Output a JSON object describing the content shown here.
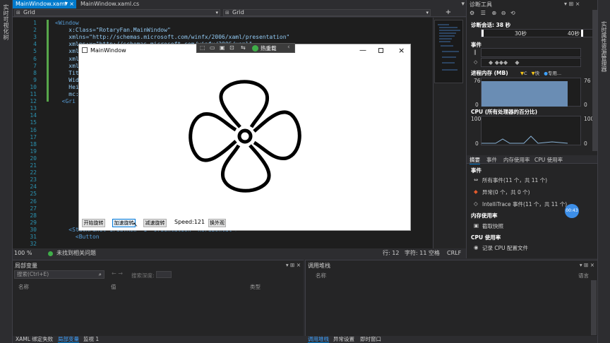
{
  "left_strip": {
    "label": "实时可视化树"
  },
  "right_strip": {
    "label": "实时属性资源管理器"
  },
  "doc_tabs": [
    {
      "label": "MainWindow.xaml",
      "pin": "▼",
      "close": "×"
    },
    {
      "label": "MainWindow.xaml.cs"
    }
  ],
  "dropdowns": {
    "left": "Grid",
    "right": "Grid"
  },
  "code_lines": [
    {
      "n": "1",
      "t": "<Window"
    },
    {
      "n": "2",
      "t": "    x:Class=\"RotaryFan.MainWindow\""
    },
    {
      "n": "3",
      "t": "    xmlns=\"http://schemas.microsoft.com/winfx/2006/xaml/presentation\""
    },
    {
      "n": "4",
      "t": "    xmlns:x=\"http://schemas.microsoft.com/winfx/2006/xaml\""
    },
    {
      "n": "5",
      "t": "    xmlns"
    },
    {
      "n": "6",
      "t": "    xmlns"
    },
    {
      "n": "7",
      "t": "    xmlns"
    },
    {
      "n": "8",
      "t": "    Titl"
    },
    {
      "n": "9",
      "t": "    Widt"
    },
    {
      "n": "10",
      "t": "    Heig"
    },
    {
      "n": "11",
      "t": "    mc:I"
    },
    {
      "n": "12",
      "t": "  <Gri"
    },
    {
      "n": "13",
      "t": ""
    },
    {
      "n": "14",
      "t": ""
    },
    {
      "n": "15",
      "t": ""
    },
    {
      "n": "16",
      "t": ""
    },
    {
      "n": "17",
      "t": ""
    },
    {
      "n": "18",
      "t": ""
    },
    {
      "n": "19",
      "t": ""
    },
    {
      "n": "20",
      "t": ""
    },
    {
      "n": "21",
      "t": ""
    },
    {
      "n": "22",
      "t": ""
    },
    {
      "n": "23",
      "t": ""
    },
    {
      "n": "24",
      "t": ""
    },
    {
      "n": "25",
      "t": ""
    },
    {
      "n": "26",
      "t": ""
    },
    {
      "n": "27",
      "t": ""
    },
    {
      "n": "28",
      "t": ""
    },
    {
      "n": "29",
      "t": ""
    },
    {
      "n": "30",
      "t": "    <StackPanel Grid.Row=\"1\" Orientation=\"Horizontal\">"
    },
    {
      "n": "31",
      "t": "      <Button"
    },
    {
      "n": "32",
      "t": ""
    }
  ],
  "editor_status": {
    "zoom": "100 %",
    "issues": "未找到相关问题",
    "line": "行: 12",
    "char": "字符: 11",
    "ws": "空格",
    "eol": "CRLF"
  },
  "app": {
    "title": "MainWindow",
    "buttons": [
      "开始旋转",
      "加速旋转",
      "减速旋转",
      "换外观"
    ],
    "speed_text": "Speed:121"
  },
  "hot_reload": {
    "label": "热重载"
  },
  "diag": {
    "title": "诊断工具",
    "session": "诊断会话: 38 秒",
    "t30": "30秒",
    "t40": "40秒",
    "events_header": "事件",
    "memory_header": "进程内存 (MB)",
    "memory_legend": [
      "C",
      "快",
      "专用..."
    ],
    "mem_max": "76",
    "mem_min": "0",
    "cpu_header": "CPU (所有处理器的百分比)",
    "cpu_max": "100",
    "cpu_min": "0",
    "tabs": [
      "摘要",
      "事件",
      "内存使用率",
      "CPU 使用率"
    ],
    "sec_events": "事件",
    "all_events": "所有事件(11 个，共 11 个)",
    "exceptions": "异常(0 个，共 0 个)",
    "intellitrace": "IntelliTrace 事件(11 个，共 11 个)",
    "sec_mem": "内存使用率",
    "snapshot": "截取快照",
    "sec_cpu": "CPU 使用率",
    "cpu_profile": "记录 CPU 配置文件",
    "badge": "00:43"
  },
  "locals": {
    "title": "局部变量",
    "search_placeholder": "搜索(Ctrl+E)",
    "depth_label": "搜索深度:",
    "cols": [
      "名称",
      "值",
      "类型"
    ]
  },
  "callstack": {
    "title": "调用堆栈",
    "cols": [
      "名称",
      "语言"
    ]
  },
  "bottom_tabs_left": [
    "XAML 绑定失败",
    "局部变量",
    "监视 1"
  ],
  "bottom_tabs_right": [
    "调用堆栈",
    "异常设置",
    "即时窗口"
  ],
  "colors": {
    "accent": "#007acc",
    "badge": "#3c8ee8"
  }
}
